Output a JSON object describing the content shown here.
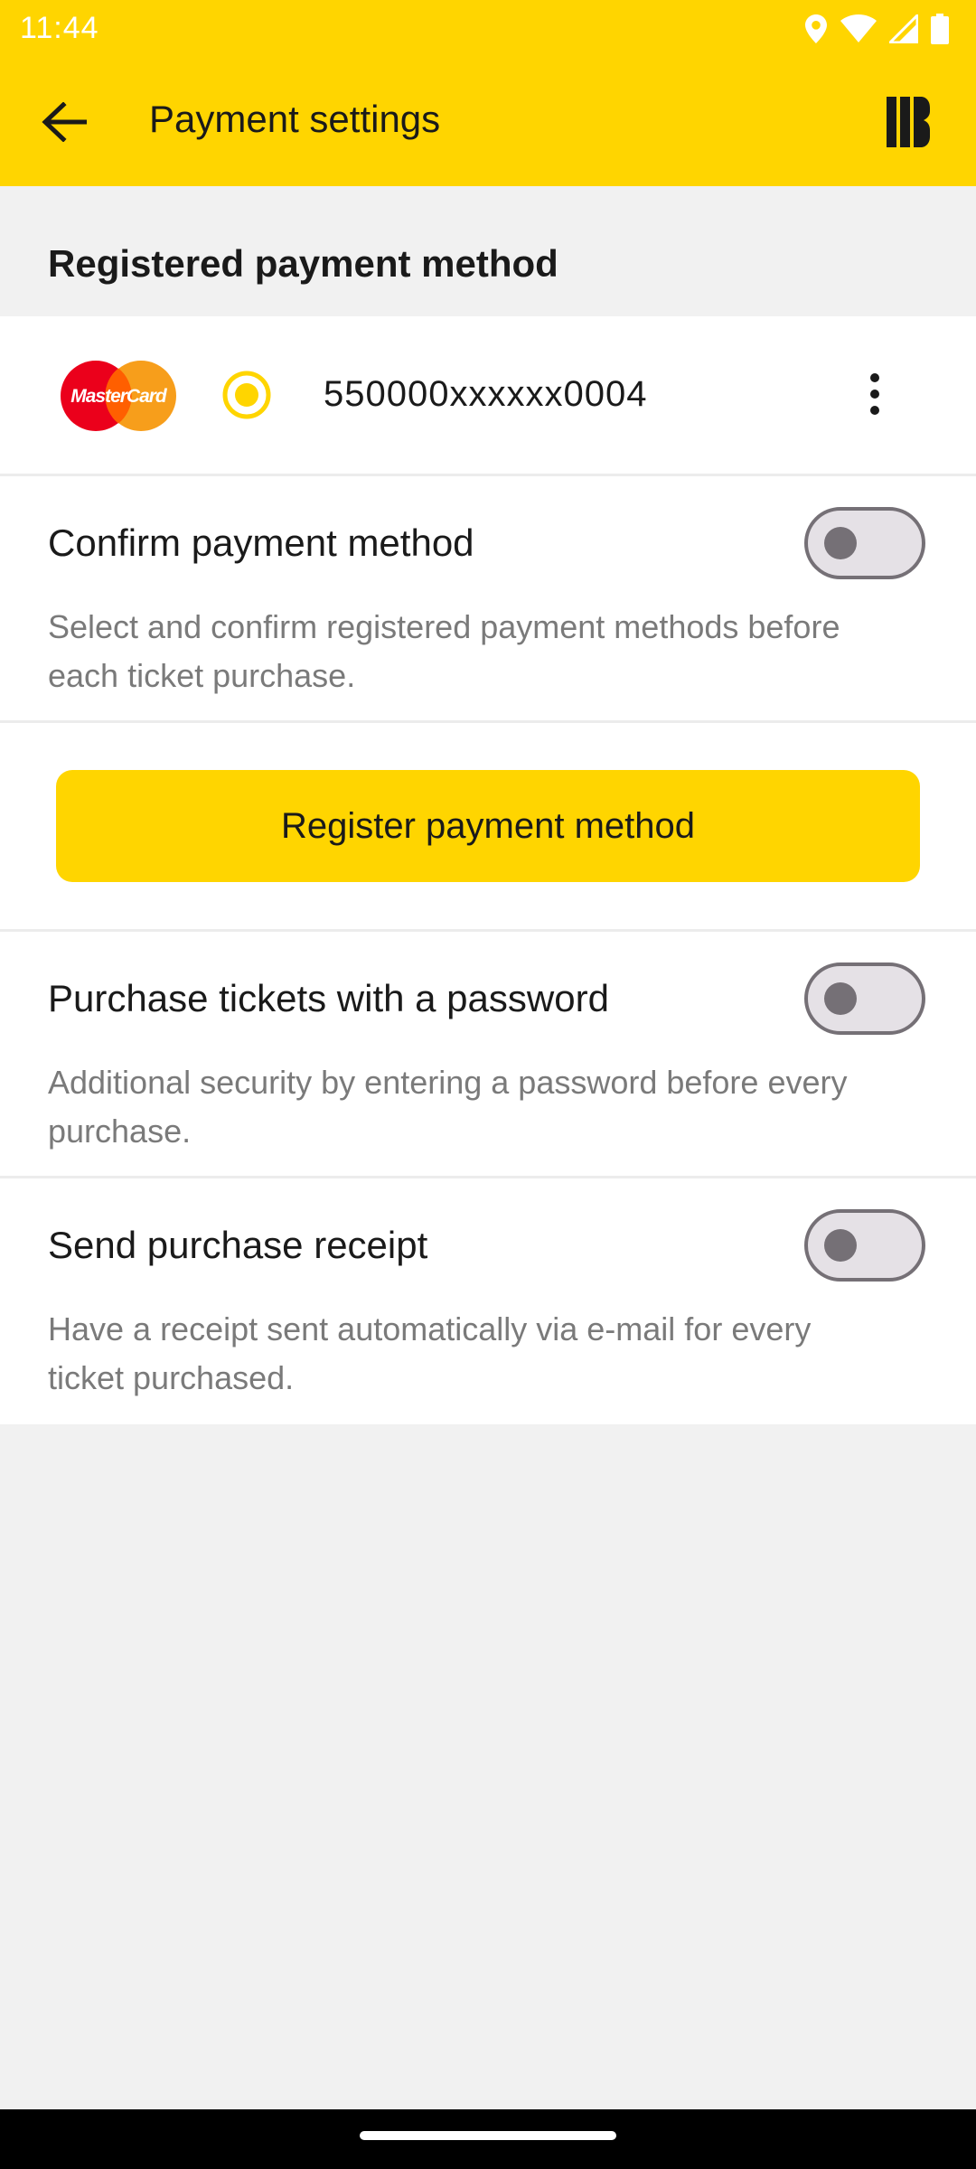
{
  "status_bar": {
    "time": "11:44",
    "icons": [
      "location-icon",
      "wifi-icon",
      "signal-icon",
      "battery-icon"
    ]
  },
  "app_bar": {
    "title": "Payment settings",
    "back_icon": "arrow-left-icon",
    "brand_icon": "app-logo-icon"
  },
  "section": {
    "registered_title": "Registered payment method"
  },
  "payment_method": {
    "brand": "MasterCard",
    "card_number": "550000xxxxxx0004",
    "selected": true
  },
  "settings": {
    "confirm": {
      "title": "Confirm payment method",
      "description": "Select and confirm registered payment methods before each ticket purchase.",
      "enabled": false
    },
    "register_button": "Register payment method",
    "password": {
      "title": "Purchase tickets with a password",
      "description": "Additional security by entering a password before every purchase.",
      "enabled": false
    },
    "receipt": {
      "title": "Send purchase receipt",
      "description": "Have a receipt sent automatically via e-mail for every ticket purchased.",
      "enabled": false
    }
  },
  "colors": {
    "accent": "#ffd500",
    "background": "#f1f1f1",
    "toggle_off": "#757076"
  }
}
